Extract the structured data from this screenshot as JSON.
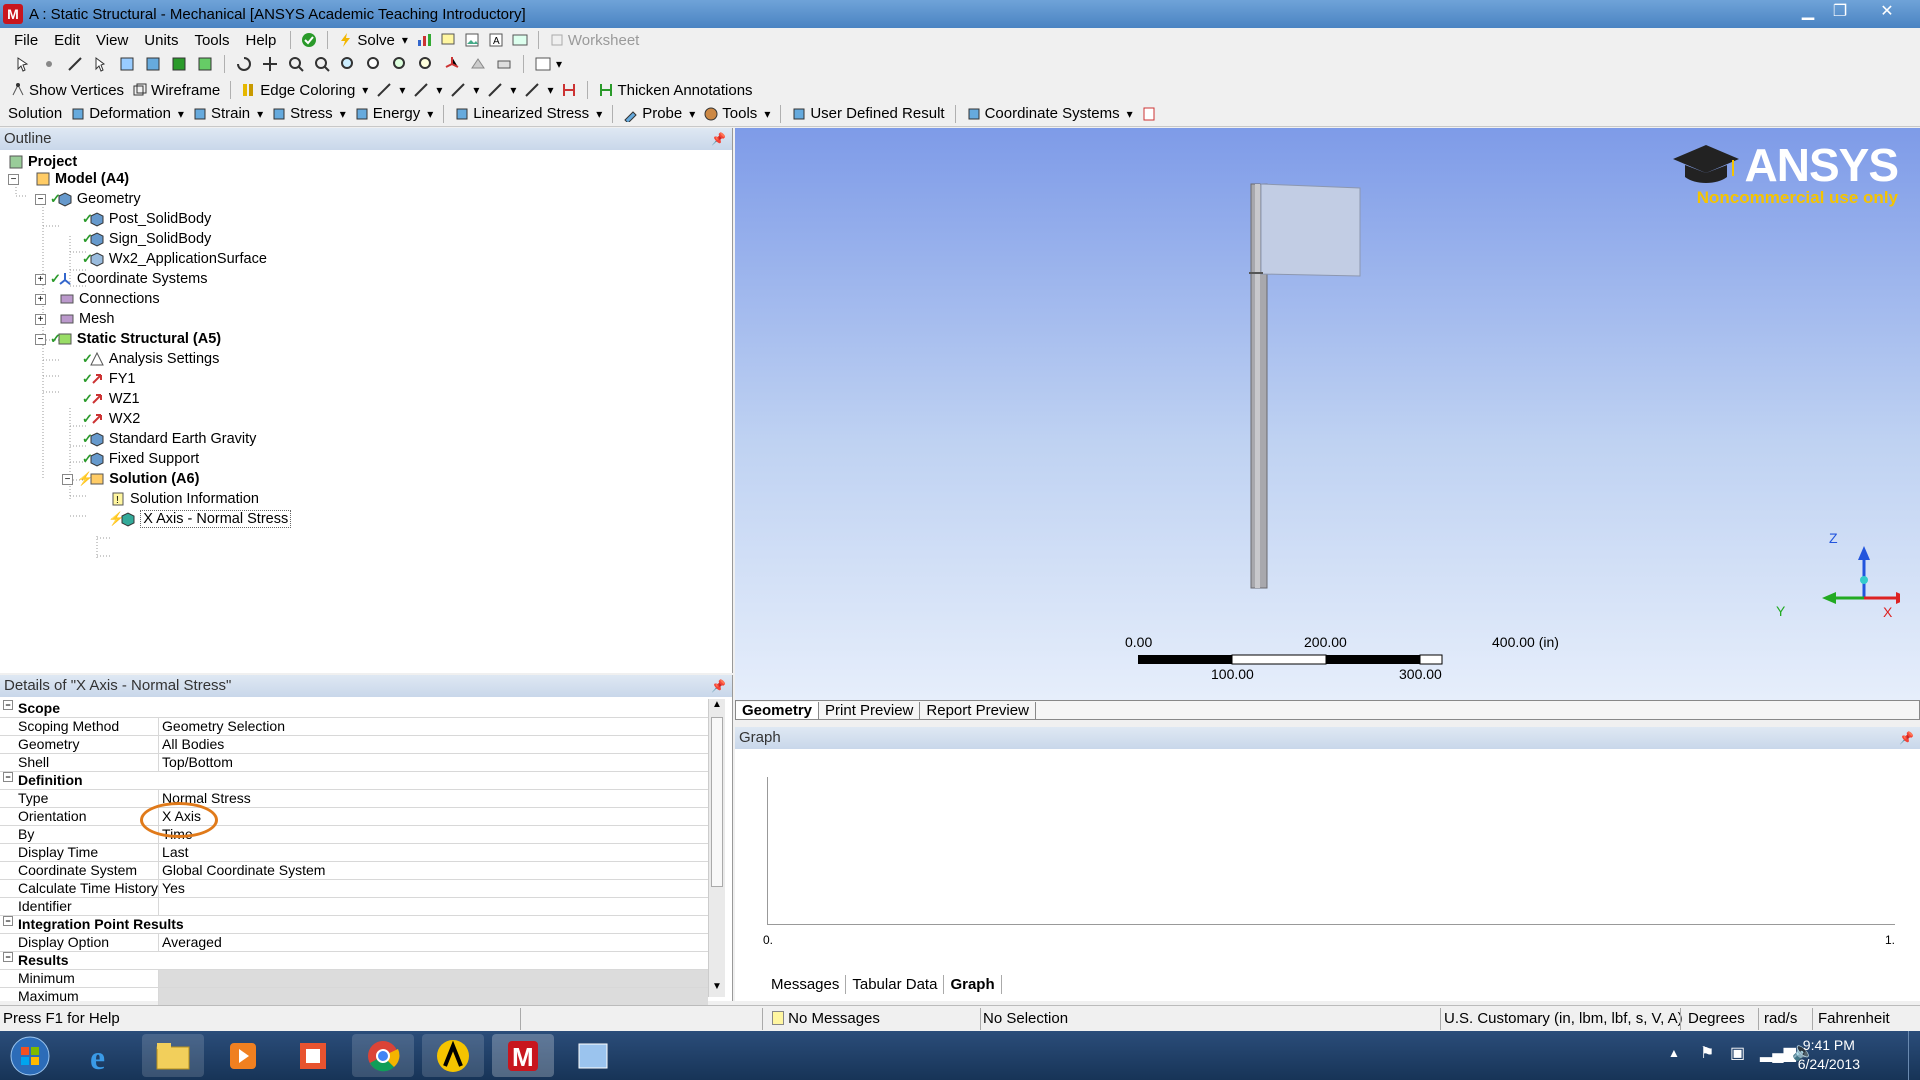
{
  "window": {
    "title": "A : Static Structural - Mechanical [ANSYS Academic Teaching Introductory]",
    "app_icon_letter": "M"
  },
  "menu": [
    "File",
    "Edit",
    "View",
    "Units",
    "Tools",
    "Help"
  ],
  "toolbar1": {
    "solve": "Solve",
    "worksheet": "Worksheet"
  },
  "toolbar2": {
    "show_vertices": "Show Vertices",
    "wireframe": "Wireframe",
    "edge_coloring": "Edge Coloring",
    "thicken_annotations": "Thicken Annotations"
  },
  "toolbar3": {
    "solution": "Solution",
    "deformation": "Deformation",
    "strain": "Strain",
    "stress": "Stress",
    "energy": "Energy",
    "linearized_stress": "Linearized Stress",
    "probe": "Probe",
    "tools": "Tools",
    "user_defined_result": "User Defined Result",
    "coordinate_systems": "Coordinate Systems"
  },
  "outline": {
    "header": "Outline",
    "items": [
      {
        "label": "Project"
      },
      {
        "label": "Model (A4)"
      },
      {
        "label": "Geometry"
      },
      {
        "label": "Post_SolidBody"
      },
      {
        "label": "Sign_SolidBody"
      },
      {
        "label": "Wx2_ApplicationSurface"
      },
      {
        "label": "Coordinate Systems"
      },
      {
        "label": "Connections"
      },
      {
        "label": "Mesh"
      },
      {
        "label": "Static Structural (A5)"
      },
      {
        "label": "Analysis Settings"
      },
      {
        "label": "FY1"
      },
      {
        "label": "WZ1"
      },
      {
        "label": "WX2"
      },
      {
        "label": "Standard Earth Gravity"
      },
      {
        "label": "Fixed Support"
      },
      {
        "label": "Solution (A6)"
      },
      {
        "label": "Solution Information"
      },
      {
        "label": "X Axis - Normal Stress"
      }
    ]
  },
  "details": {
    "header": "Details of \"X Axis - Normal Stress\"",
    "groups": {
      "scope": "Scope",
      "definition": "Definition",
      "integration": "Integration Point Results",
      "results": "Results"
    },
    "rows": {
      "scoping_method": {
        "k": "Scoping Method",
        "v": "Geometry Selection"
      },
      "geometry": {
        "k": "Geometry",
        "v": "All Bodies"
      },
      "shell": {
        "k": "Shell",
        "v": "Top/Bottom"
      },
      "type": {
        "k": "Type",
        "v": "Normal Stress"
      },
      "orientation": {
        "k": "Orientation",
        "v": "X Axis"
      },
      "by": {
        "k": "By",
        "v": "Time"
      },
      "display_time": {
        "k": "Display Time",
        "v": "Last"
      },
      "coord_system": {
        "k": "Coordinate System",
        "v": "Global Coordinate System"
      },
      "calc_time_history": {
        "k": "Calculate Time History",
        "v": "Yes"
      },
      "identifier": {
        "k": "Identifier",
        "v": ""
      },
      "display_option": {
        "k": "Display Option",
        "v": "Averaged"
      },
      "minimum": {
        "k": "Minimum",
        "v": ""
      },
      "maximum": {
        "k": "Maximum",
        "v": ""
      }
    }
  },
  "viewport": {
    "logo": "ANSYS",
    "logo_sub": "Noncommercial use only",
    "scale": {
      "l0": "0.00",
      "l200": "200.00",
      "l400": "400.00 (in)",
      "l100": "100.00",
      "l300": "300.00"
    },
    "axes": {
      "z": "Z",
      "y": "Y",
      "x": "X"
    }
  },
  "view_tabs": [
    "Geometry",
    "Print Preview",
    "Report Preview"
  ],
  "graph": {
    "header": "Graph",
    "x_start": "0.",
    "x_end": "1.",
    "tabs": [
      "Messages",
      "Tabular Data",
      "Graph"
    ]
  },
  "status": {
    "help": "Press F1 for Help",
    "messages": "No Messages",
    "selection": "No Selection",
    "units": "U.S. Customary (in, lbm, lbf, s, V, A)",
    "angle": "Degrees",
    "rate": "rad/s",
    "temp": "Fahrenheit"
  },
  "taskbar": {
    "time": "9:41 PM",
    "date": "6/24/2013"
  },
  "colors": {
    "accent": "#e07a1a",
    "viewport_top": "#7e9be8",
    "check": "#2a9a2a"
  }
}
